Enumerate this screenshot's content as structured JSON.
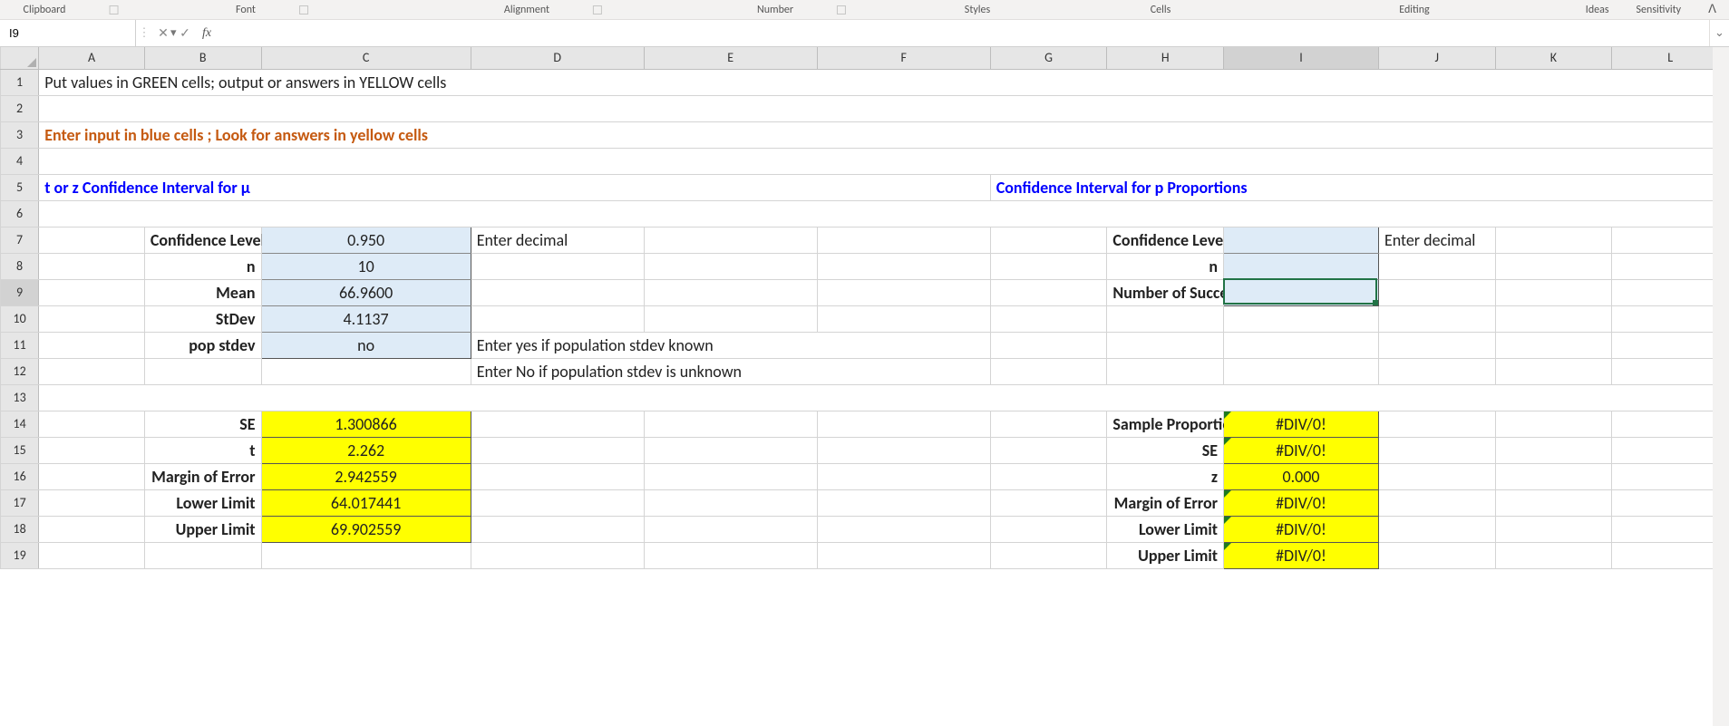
{
  "ribbon": {
    "groups": [
      "Clipboard",
      "Font",
      "Alignment",
      "Number",
      "Styles",
      "Cells",
      "Editing"
    ],
    "right": [
      "Ideas",
      "Sensitivity"
    ]
  },
  "formula_bar": {
    "name_box": "I9",
    "cancel": "✕",
    "enter": "✓",
    "fx": "fx",
    "formula": ""
  },
  "columns": [
    "A",
    "B",
    "C",
    "D",
    "E",
    "F",
    "G",
    "H",
    "I",
    "J",
    "K",
    "L"
  ],
  "rows": [
    "1",
    "2",
    "3",
    "4",
    "5",
    "6",
    "7",
    "8",
    "9",
    "10",
    "11",
    "12",
    "13",
    "14",
    "15",
    "16",
    "17",
    "18",
    "19"
  ],
  "cells": {
    "r1": {
      "A": "Put values in GREEN cells; output or answers in YELLOW cells"
    },
    "r3": {
      "A": "Enter input in blue cells ; Look for answers in yellow cells"
    },
    "r5": {
      "A": "t  or z Confidence Interval for μ",
      "G": "Confidence Interval for p Proportions"
    },
    "r7": {
      "B": "Confidence Level",
      "C": "0.950",
      "D": "Enter decimal",
      "H": "Confidence Level",
      "I": "",
      "J": "Enter decimal"
    },
    "r8": {
      "B": "n",
      "C": "10",
      "H": "n",
      "I": ""
    },
    "r9": {
      "B": "Mean",
      "C": "66.9600",
      "H": "Number of Successes",
      "I": ""
    },
    "r10": {
      "B": "StDev",
      "C": "4.1137"
    },
    "r11": {
      "B": "pop stdev",
      "C": "no",
      "D": "Enter yes if population stdev known"
    },
    "r12": {
      "D": "Enter No if population stdev is unknown"
    },
    "r14": {
      "B": "SE",
      "C": "1.300866",
      "H": "Sample Proportion",
      "I": "#DIV/0!"
    },
    "r15": {
      "B": "t",
      "C": "2.262",
      "H": "SE",
      "I": "#DIV/0!"
    },
    "r16": {
      "B": "Margin of Error",
      "C": "2.942559",
      "H": "z",
      "I": "0.000"
    },
    "r17": {
      "B": "Lower Limit",
      "C": "64.017441",
      "H": "Margin of Error",
      "I": "#DIV/0!"
    },
    "r18": {
      "B": "Upper Limit",
      "C": "69.902559",
      "H": "Lower Limit",
      "I": "#DIV/0!"
    },
    "r19": {
      "H": "Upper Limit",
      "I": "#DIV/0!"
    }
  },
  "active_cell": "I9"
}
